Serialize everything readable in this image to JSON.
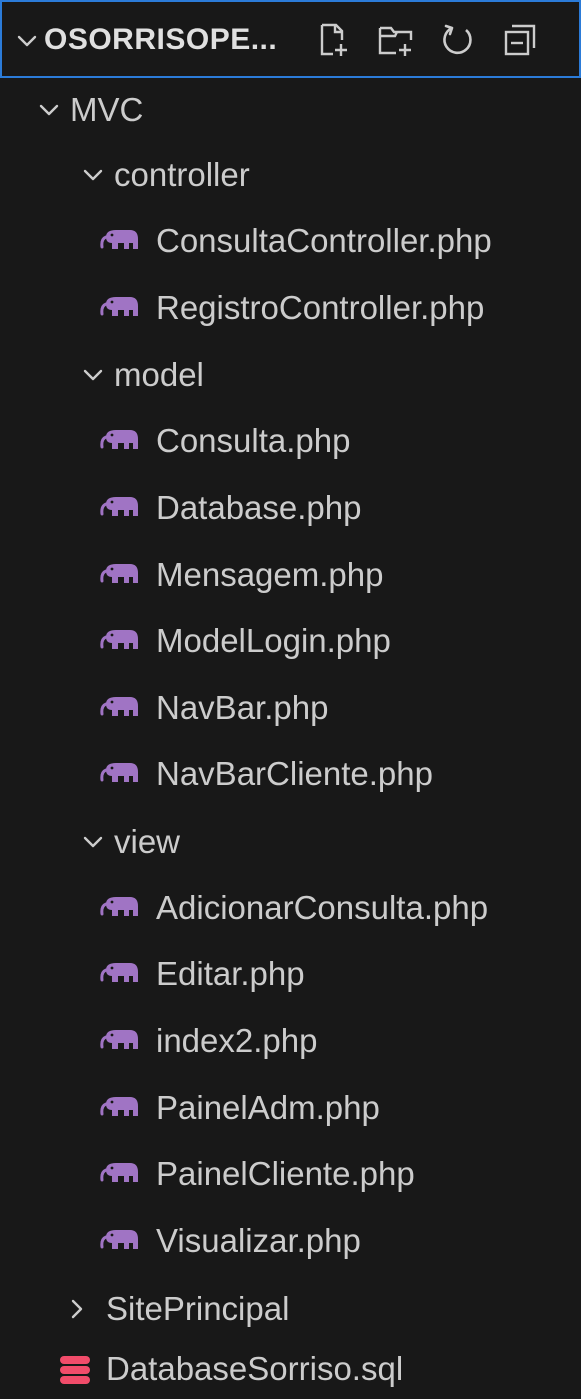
{
  "explorer": {
    "title": "OSORRISOPE...",
    "actions": [
      {
        "name": "new-file-icon"
      },
      {
        "name": "new-folder-icon"
      },
      {
        "name": "refresh-icon"
      },
      {
        "name": "collapse-all-icon"
      }
    ],
    "tree": {
      "mvc": "MVC",
      "controller": "controller",
      "controller_files": [
        "ConsultaController.php",
        "RegistroController.php"
      ],
      "model": "model",
      "model_files": [
        "Consulta.php",
        "Database.php",
        "Mensagem.php",
        "ModelLogin.php",
        "NavBar.php",
        "NavBarCliente.php"
      ],
      "view": "view",
      "view_files": [
        "AdicionarConsulta.php",
        "Editar.php",
        "index2.php",
        "PainelAdm.php",
        "PainelCliente.php",
        "Visualizar.php"
      ],
      "site_principal": "SitePrincipal",
      "sql_file": "DatabaseSorriso.sql"
    },
    "colors": {
      "background": "#181818",
      "focus_border": "#2b7bd8",
      "php_icon": "#a074c4",
      "sql_icon": "#f14c6a",
      "text": "#cccccc"
    }
  }
}
